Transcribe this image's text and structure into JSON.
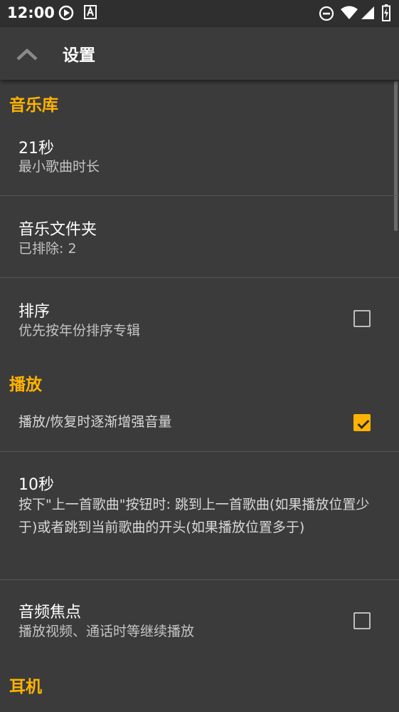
{
  "status_bar": {
    "time": "12:00",
    "icons": [
      "media-play-icon",
      "keyboard-a-icon",
      "do-not-disturb-icon",
      "wifi-icon",
      "signal-icon",
      "battery-charging-icon"
    ]
  },
  "app_bar": {
    "title": "设置",
    "up_icon": "chevron-up-icon"
  },
  "sections": [
    {
      "header": "音乐库",
      "items": [
        {
          "title": "21秒",
          "summary": "最小歌曲时长",
          "checkbox": null
        },
        {
          "title": "音乐文件夹",
          "summary": "已排除: 2",
          "checkbox": null
        },
        {
          "title": "排序",
          "summary": "优先按年份排序专辑",
          "checkbox": false
        }
      ]
    },
    {
      "header": "播放",
      "items": [
        {
          "title": "",
          "summary": "播放/恢复时逐渐增强音量",
          "checkbox": true
        },
        {
          "title": "10秒",
          "summary": "按下\"上一首歌曲\"按钮时: 跳到上一首歌曲(如果播放位置少于)或者跳到当前歌曲的开头(如果播放位置多于)",
          "checkbox": null
        },
        {
          "title": "音频焦点",
          "summary": "播放视频、通话时等继续播放",
          "checkbox": false
        }
      ]
    },
    {
      "header": "耳机",
      "items": []
    }
  ],
  "colors": {
    "background": "#3b3b3b",
    "status_bar": "#2f2f2f",
    "accent": "#ffb300",
    "summary_text": "#c4c4c4",
    "divider": "#555555"
  }
}
